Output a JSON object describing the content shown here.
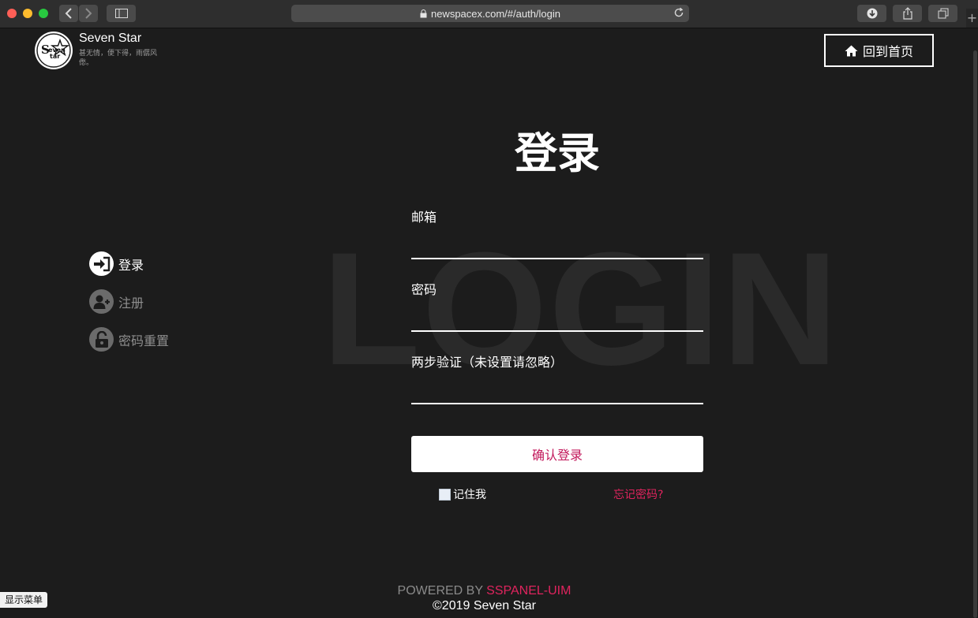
{
  "browser": {
    "url": "newspacex.com/#/auth/login"
  },
  "header": {
    "brand_name": "Seven Star",
    "tagline": "甚无情，便下得，雨僝风僽。",
    "home_button": "回到首页"
  },
  "background_text": "LOGIN",
  "sidebar": {
    "items": [
      {
        "label": "登录",
        "icon": "sign-in-icon",
        "active": true
      },
      {
        "label": "注册",
        "icon": "user-plus-icon",
        "active": false
      },
      {
        "label": "密码重置",
        "icon": "unlock-icon",
        "active": false
      }
    ]
  },
  "form": {
    "title": "登录",
    "email_label": "邮箱",
    "email_value": "",
    "password_label": "密码",
    "password_value": "",
    "twofa_label": "两步验证（未设置请忽略）",
    "twofa_value": "",
    "submit_label": "确认登录",
    "remember_label": "记住我",
    "remember_checked": false,
    "forgot_label": "忘记密码?"
  },
  "footer": {
    "powered_prefix": "POWERED BY",
    "powered_link": "SSPANEL-UIM",
    "copyright": "©2019 Seven Star"
  },
  "show_menu_label": "显示菜单",
  "colors": {
    "background": "#1c1c1c",
    "accent": "#e0245e",
    "primary_text": "#ffffff"
  }
}
